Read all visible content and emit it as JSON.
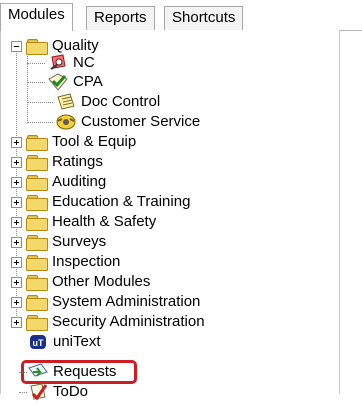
{
  "tabs": [
    {
      "label": "Modules",
      "active": true
    },
    {
      "label": "Reports",
      "active": false
    },
    {
      "label": "Shortcuts",
      "active": false
    }
  ],
  "tree": {
    "quality": {
      "label": "Quality",
      "children": [
        "NC",
        "CPA",
        "Doc Control",
        "Customer Service"
      ]
    },
    "collapsed_folders": [
      "Tool & Equip",
      "Ratings",
      "Auditing",
      "Education & Training",
      "Health & Safety",
      "Surveys",
      "Inspection",
      "Other Modules",
      "System Administration",
      "Security Administration"
    ],
    "leaf_items": [
      "uniText",
      "Requests",
      "ToDo"
    ]
  },
  "colors": {
    "folder": "#f5d86a",
    "highlight": "#cc1f25"
  },
  "icons": {
    "nc": "nc-icon",
    "cpa": "cpa-check-icon",
    "doc_control": "doc-control-icon",
    "customer_service": "customer-service-icon",
    "unitext": "unitext-icon",
    "requests": "requests-icon",
    "todo": "todo-icon"
  }
}
